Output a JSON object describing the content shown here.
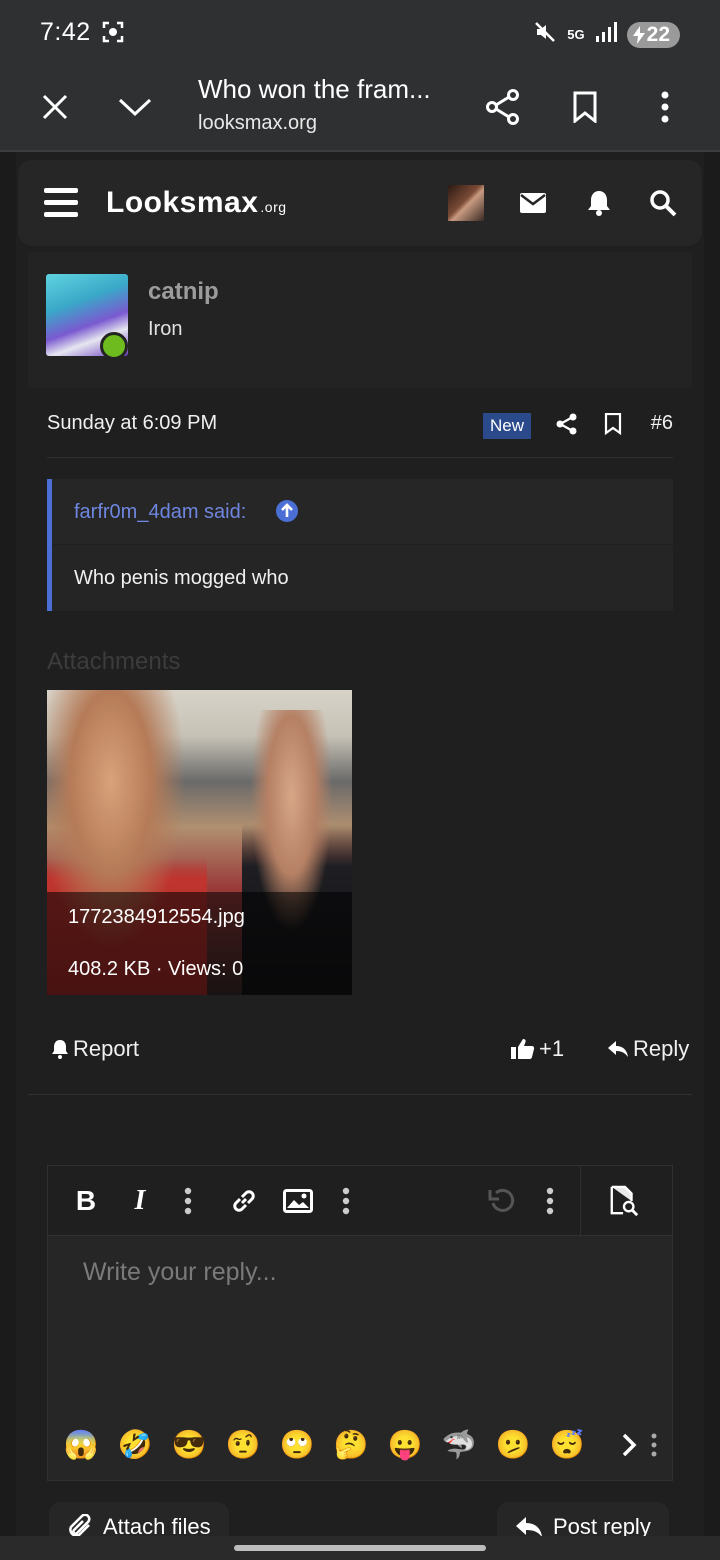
{
  "status_bar": {
    "time": "7:42",
    "battery": "22",
    "network": "5G"
  },
  "browser": {
    "title": "Who won the fram...",
    "url": "looksmax.org"
  },
  "site": {
    "logo": "Looksmax",
    "logo_suffix": ".org"
  },
  "post": {
    "username": "catnip",
    "rank": "Iron",
    "date": "Sunday at 6:09 PM",
    "badge": "New",
    "number": "#6",
    "quote_author": "farfr0m_4dam said:",
    "quote_text": "Who penis mogged who",
    "attachments_title": "Attachments",
    "attachment": {
      "filename": "1772384912554.jpg",
      "meta": "408.2 KB · Views: 0"
    },
    "report_label": "Report",
    "like_label": "+1",
    "reply_label": "Reply"
  },
  "editor": {
    "placeholder": "Write your reply...",
    "emojis": [
      "😱",
      "🤣",
      "😎",
      "🤨",
      "🙄",
      "🤔",
      "😛",
      "🦈",
      "🫤",
      "😴"
    ]
  },
  "buttons": {
    "attach_files": "Attach files",
    "post_reply": "Post reply"
  },
  "colors": {
    "accent": "#4b6fd4",
    "badge": "#2b4a8b",
    "online": "#6dbb1e"
  }
}
